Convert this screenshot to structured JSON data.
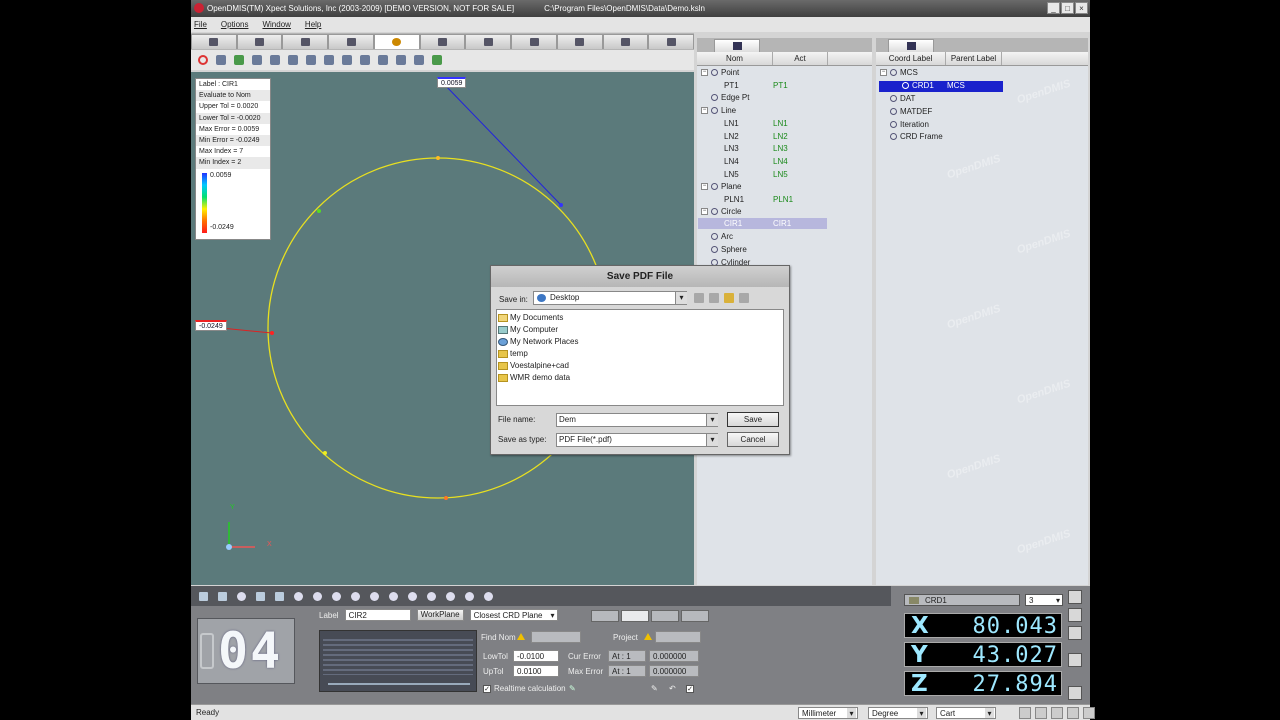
{
  "title": {
    "app": "OpenDMIS(TM) Xpect Solutions, Inc (2003-2009) [DEMO VERSION, NOT FOR SALE]",
    "path": "C:\\Program Files\\OpenDMIS\\Data\\Demo.ksln",
    "buttons": [
      "_",
      "□",
      "×"
    ]
  },
  "menu": [
    "File",
    "Options",
    "Window",
    "Help"
  ],
  "viewport": {
    "info": [
      "Label : CIR1",
      "Evaluate to Nom",
      "Upper Tol = 0.0020",
      "Lower Tol = -0.0020",
      "Max Error = 0.0059",
      "Min Error = -0.0249",
      "Max Index = 7",
      "Min Index = 2"
    ],
    "grad_max": "0.0059",
    "grad_min": "-0.0249",
    "tag_max": "0.0059",
    "tag_min": "-0.0249",
    "axis_y": "Y",
    "axis_x": "X",
    "circle_color": "#e8e020"
  },
  "feature_tree": {
    "col_nom": "Nom",
    "col_act": "Act",
    "groups": {
      "point": "Point",
      "pt1_nom": "PT1",
      "pt1_act": "PT1",
      "edgept": "Edge Pt",
      "line": "Line",
      "ln1_nom": "LN1",
      "ln1_act": "LN1",
      "ln2_nom": "LN2",
      "ln2_act": "LN2",
      "ln3_nom": "LN3",
      "ln3_act": "LN3",
      "ln4_nom": "LN4",
      "ln4_act": "LN4",
      "ln5_nom": "LN5",
      "ln5_act": "LN5",
      "plane": "Plane",
      "pln1_nom": "PLN1",
      "pln1_act": "PLN1",
      "circle": "Circle",
      "cir1_nom": "CIR1",
      "cir1_act": "CIR1",
      "arc": "Arc",
      "sphere": "Sphere",
      "cylinder": "Cylinder"
    }
  },
  "coord_tree": {
    "col_label": "Coord Label",
    "col_parent": "Parent Label",
    "mcs": "MCS",
    "crd1": "CRD1",
    "crd1_parent": "MCS",
    "dat": "DAT",
    "matdef": "MATDEF",
    "iteration": "Iteration",
    "crdframe": "CRD Frame",
    "watermark": "OpenDMIS"
  },
  "dialog": {
    "title": "Save PDF File",
    "save_in_label": "Save in:",
    "save_in_value": "Desktop",
    "items": [
      "My Documents",
      "My Computer",
      "My Network Places",
      "temp",
      "Voestalpine+cad",
      "WMR demo data"
    ],
    "filename_label": "File name:",
    "filename_value": "Dem",
    "saveas_label": "Save as type:",
    "saveas_value": "PDF File(*.pdf)",
    "save_btn": "Save",
    "cancel_btn": "Cancel"
  },
  "bottom": {
    "count": "04",
    "label_caption": "Label",
    "label_value": "CIR2",
    "workplane_btn": "WorkPlane",
    "plane_select": "Closest CRD Plane",
    "find_nom": "Find Nom",
    "project": "Project",
    "low_tol_label": "LowTol",
    "low_tol": "-0.0100",
    "up_tol_label": "UpTol",
    "up_tol": "0.0100",
    "cur_error": "Cur Error",
    "max_error": "Max Error",
    "at_cur": "At : 1",
    "at_max": "At : 1",
    "cur_val": "0.000000",
    "max_val": "0.000000",
    "realtime": "Realtime calculation"
  },
  "coords": {
    "system": "CRD1",
    "digits": "3",
    "x_label": "X",
    "x": "80.043",
    "y_label": "Y",
    "y": "43.027",
    "z_label": "Z",
    "z": "27.894"
  },
  "status": {
    "text": "Ready",
    "units": "Millimeter",
    "angle": "Degree",
    "coord_type": "Cart"
  }
}
